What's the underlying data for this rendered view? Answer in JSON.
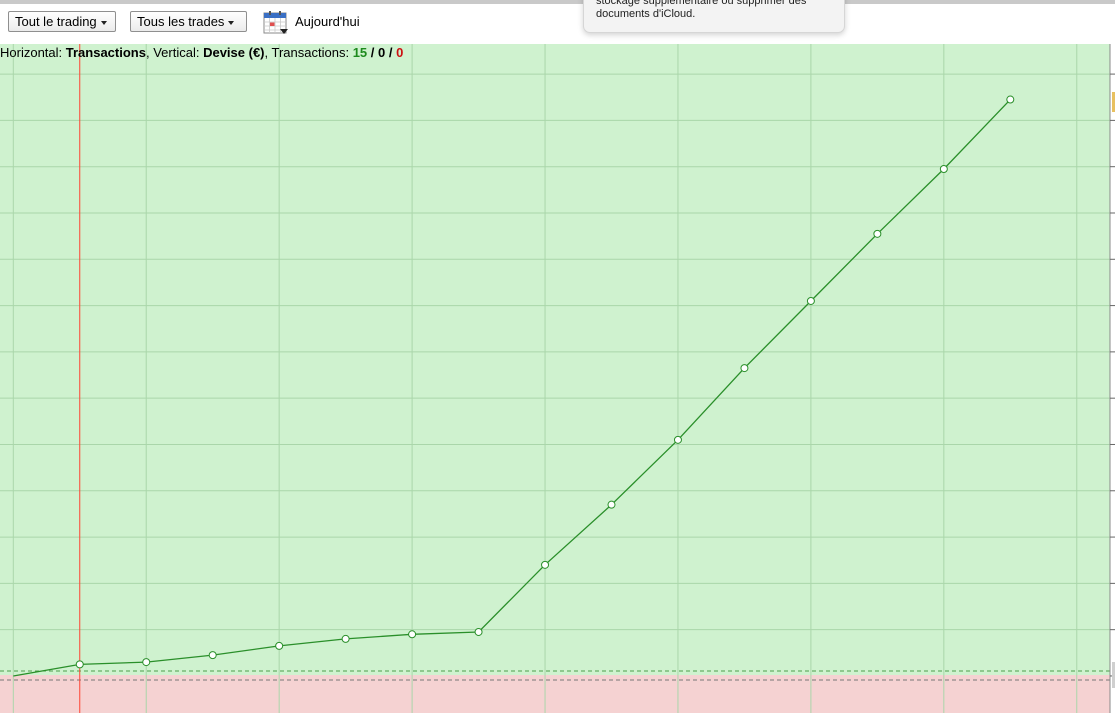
{
  "toolbar": {
    "filter_trading": "Tout le trading",
    "filter_trades": "Tous les trades",
    "calendar_icon": "calendar-icon",
    "today_label": "Aujourd'hui"
  },
  "notification": {
    "text": "stockage supplémentaire ou supprimer des\ndocuments d'iCloud."
  },
  "info": {
    "horizontal_label": "Horizontal:",
    "horizontal_value": "Transactions",
    "vertical_label": "Vertical:",
    "vertical_value": "Devise (€)",
    "transactions_label": "Transactions:",
    "count_win": "15",
    "count_even": "0",
    "count_loss": "0",
    "sep": " / "
  },
  "colors": {
    "profit_zone": "#cff2cf",
    "loss_zone": "#f5d2d2",
    "equity_line": "#2a8f2a",
    "marker_line": "#ff4433",
    "grid": "#aad6aa"
  },
  "chart_data": {
    "type": "line",
    "x": [
      0,
      1,
      2,
      3,
      4,
      5,
      6,
      7,
      8,
      9,
      10,
      11,
      12,
      13,
      14,
      15
    ],
    "series": [
      {
        "values": [
          0,
          0.5,
          0.6,
          0.9,
          1.3,
          1.6,
          1.8,
          1.9,
          4.8,
          7.4,
          10.2,
          13.3,
          16.2,
          19.1,
          21.9,
          24.9
        ]
      }
    ],
    "marked_x": 1,
    "xlim": [
      -0.2,
      16.5
    ],
    "ylim": [
      -1.6,
      27.3
    ],
    "grid": true
  }
}
